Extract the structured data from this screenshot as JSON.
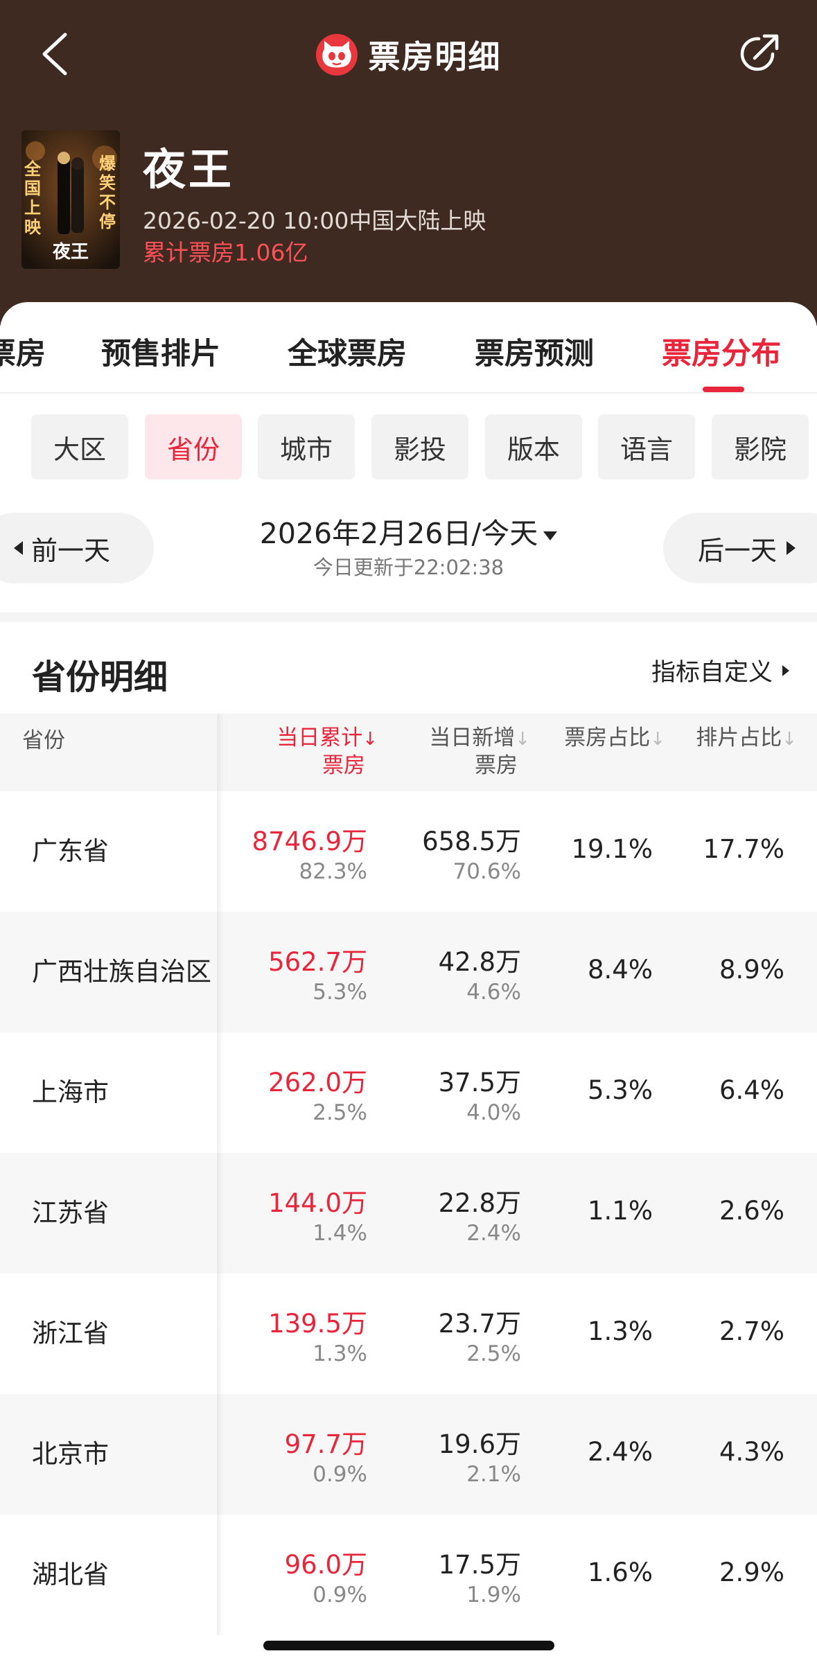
{
  "header": {
    "title": "票房明细",
    "movie_name": "夜王",
    "release": "2026-02-20 10:00中国大陆上映",
    "cumulative": "累计票房1.06亿",
    "poster_text_left": "全国上映",
    "poster_text_right": "爆笑不停",
    "poster_title": "夜王"
  },
  "tabs": [
    {
      "label": "票房"
    },
    {
      "label": "预售排片"
    },
    {
      "label": "全球票房"
    },
    {
      "label": "票房预测"
    },
    {
      "label": "票房分布"
    }
  ],
  "active_tab": "票房分布",
  "chips": [
    {
      "label": "大区"
    },
    {
      "label": "省份"
    },
    {
      "label": "城市"
    },
    {
      "label": "影投"
    },
    {
      "label": "版本"
    },
    {
      "label": "语言"
    },
    {
      "label": "影院"
    }
  ],
  "active_chip": "省份",
  "date": {
    "prev": "前一天",
    "next": "后一天",
    "current": "2026年2月26日/今天",
    "update": "今日更新于22:02:38"
  },
  "section": {
    "title": "省份明细",
    "customize": "指标自定义"
  },
  "table": {
    "headers": {
      "province": "省份",
      "cum_line1": "当日累计",
      "cum_line2": "票房",
      "new_line1": "当日新增",
      "new_line2": "票房",
      "share": "票房占比",
      "schedule": "排片占比",
      "arrow": "↓"
    },
    "rows": [
      {
        "province": "广东省",
        "cum": "8746.9万",
        "cum_pct": "82.3%",
        "new": "658.5万",
        "new_pct": "70.6%",
        "share": "19.1%",
        "schedule": "17.7%"
      },
      {
        "province": "广西壮族自治区",
        "cum": "562.7万",
        "cum_pct": "5.3%",
        "new": "42.8万",
        "new_pct": "4.6%",
        "share": "8.4%",
        "schedule": "8.9%"
      },
      {
        "province": "上海市",
        "cum": "262.0万",
        "cum_pct": "2.5%",
        "new": "37.5万",
        "new_pct": "4.0%",
        "share": "5.3%",
        "schedule": "6.4%"
      },
      {
        "province": "江苏省",
        "cum": "144.0万",
        "cum_pct": "1.4%",
        "new": "22.8万",
        "new_pct": "2.4%",
        "share": "1.1%",
        "schedule": "2.6%"
      },
      {
        "province": "浙江省",
        "cum": "139.5万",
        "cum_pct": "1.3%",
        "new": "23.7万",
        "new_pct": "2.5%",
        "share": "1.3%",
        "schedule": "2.7%"
      },
      {
        "province": "北京市",
        "cum": "97.7万",
        "cum_pct": "0.9%",
        "new": "19.6万",
        "new_pct": "2.1%",
        "share": "2.4%",
        "schedule": "4.3%"
      },
      {
        "province": "湖北省",
        "cum": "96.0万",
        "cum_pct": "0.9%",
        "new": "17.5万",
        "new_pct": "1.9%",
        "share": "1.6%",
        "schedule": "2.9%"
      }
    ]
  },
  "icons": {
    "back": "chevron-left-icon",
    "share": "share-icon",
    "logo": "cat-logo-icon"
  },
  "colors": {
    "header_bg": "#3e2a20",
    "accent": "#e8253a",
    "cumulative": "#ff5058"
  }
}
